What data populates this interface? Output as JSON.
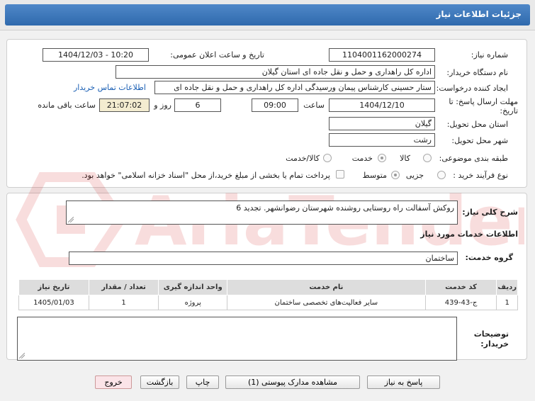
{
  "header": {
    "title": "جزئیات اطلاعات نیاز"
  },
  "info": {
    "need_number_label": "شماره نیاز:",
    "need_number": "1104001162000274",
    "announce_label": "تاریخ و ساعت اعلان عمومی:",
    "announce_value": "1404/12/03 - 10:20",
    "buyer_org_label": "نام دستگاه خریدار:",
    "buyer_org": "اداره کل راهداری و حمل و نقل جاده ای استان گیلان",
    "requester_label": "ایجاد کننده درخواست:",
    "requester": "ستار حسینی کارشناس پیمان ورسیدگی اداره کل راهداری و حمل و نقل جاده ای",
    "contact_link": "اطلاعات تماس خریدار",
    "deadline_label": "مهلت ارسال پاسخ: تا تاریخ:",
    "deadline_date": "1404/12/10",
    "time_label": "ساعت",
    "deadline_time": "09:00",
    "days_value": "6",
    "days_label": "روز و",
    "remaining_time": "21:07:02",
    "remaining_label": "ساعت باقی مانده",
    "province_label": "استان محل تحویل:",
    "province": "گیلان",
    "city_label": "شهر محل تحویل:",
    "city": "رشت",
    "category_label": "طبقه بندی موضوعی:",
    "category_options": [
      "کالا",
      "خدمت",
      "کالا/خدمت"
    ],
    "category_selected": "خدمت",
    "process_label": "نوع فرآیند خرید :",
    "process_options": [
      "جزیی",
      "متوسط"
    ],
    "process_selected": "متوسط",
    "payment_note": "پرداخت تمام یا بخشی از مبلغ خرید،از محل \"اسناد خزانه اسلامی\" خواهد بود."
  },
  "details": {
    "summary_label": "شرح کلی نیاز:",
    "summary": "روکش آسفالت راه روستایی روشنده شهرستان رضوانشهر. تجدید 6",
    "services_heading": "اطلاعات خدمات مورد نیاز",
    "service_group_label": "گروه خدمت:",
    "service_group": "ساختمان",
    "table": {
      "headers": [
        "ردیف",
        "کد خدمت",
        "نام خدمت",
        "واحد اندازه گیری",
        "تعداد / مقدار",
        "تاریخ نیاز"
      ],
      "rows": [
        [
          "1",
          "ج-43-439",
          "سایر فعالیت‌های تخصصی ساختمان",
          "پروژه",
          "1",
          "1405/01/03"
        ]
      ]
    },
    "buyer_notes_label": "توضیحات خریدار:",
    "buyer_notes": ""
  },
  "buttons": {
    "reply": "پاسخ به نیاز",
    "attachments": "مشاهده مدارک پیوستی (1)",
    "print": "چاپ",
    "back": "بازگشت",
    "exit": "خروج"
  },
  "colors": {
    "header_blue": "#3b76b9",
    "timer_bg": "#f3ecd0",
    "link_blue": "#1a5fb4",
    "exit_pink": "#fbe4e8"
  }
}
